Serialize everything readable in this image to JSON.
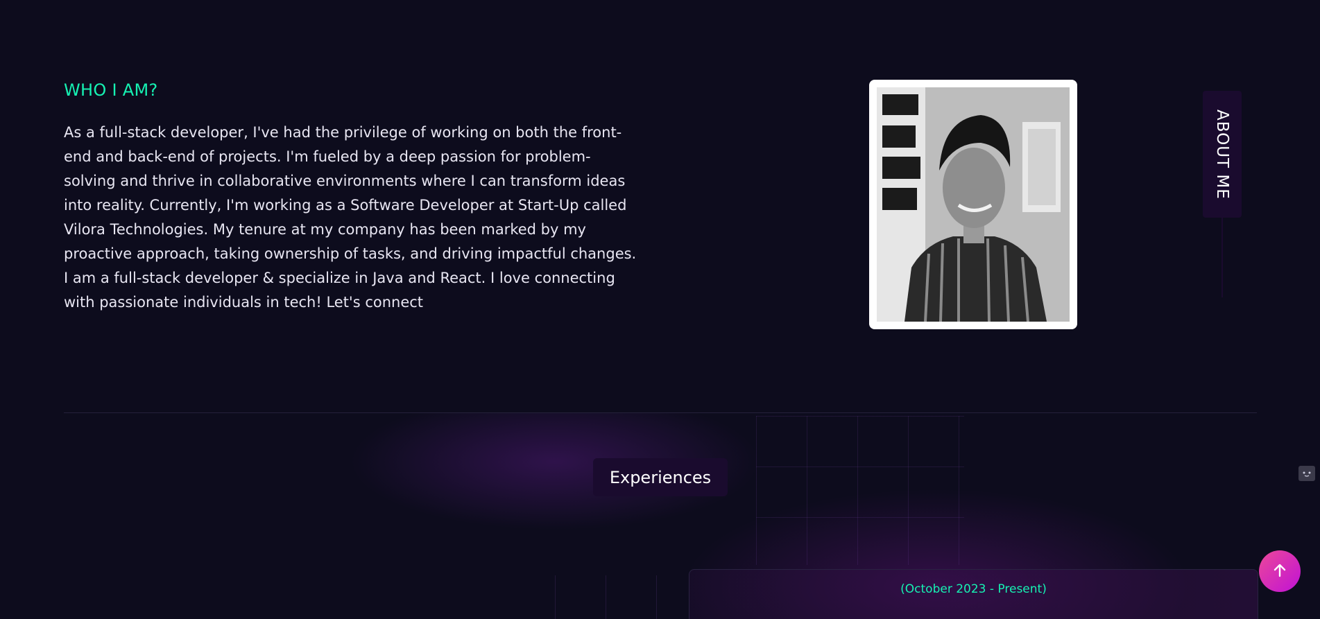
{
  "about": {
    "heading": "WHO I AM?",
    "description": "As a full-stack developer, I've had the privilege of working on both the front-end and back-end of projects. I'm fueled by a deep passion for problem-solving and thrive in collaborative environments where I can transform ideas into reality. Currently, I'm working as a Software Developer at Start-Up called Vilora Technologies. My tenure at my company has been marked by my proactive approach, taking ownership of tasks, and driving impactful changes. I am a full-stack developer & specialize in Java and React. I love connecting with passionate individuals in tech! Let's connect",
    "side_tab_label": "ABOUT ME"
  },
  "experience": {
    "section_title": "Experiences",
    "items": [
      {
        "date": "(October 2023 - Present)"
      }
    ]
  },
  "icons": {
    "scroll_top": "arrow-up-icon",
    "side_widget": "widget-icon"
  },
  "colors": {
    "background": "#0d0c1d",
    "accent": "#16f2b3",
    "badge": "#1a0b2e",
    "button_gradient_start": "#ec4899",
    "button_gradient_end": "#c012d6"
  }
}
